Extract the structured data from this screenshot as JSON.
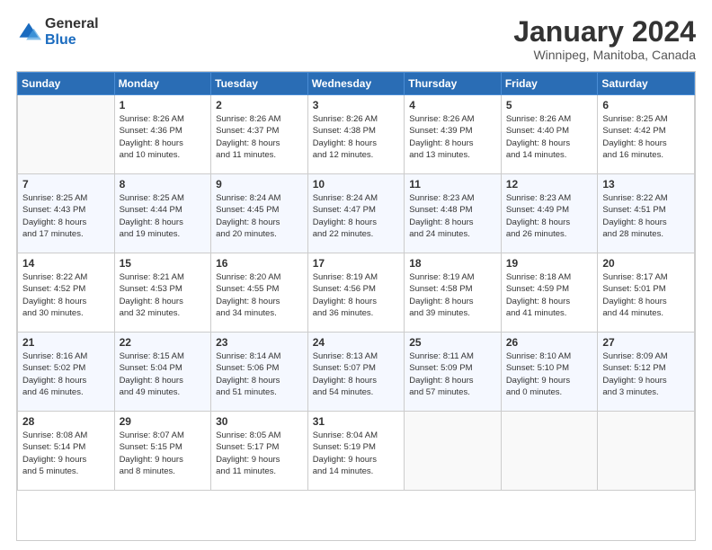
{
  "header": {
    "logo": {
      "general": "General",
      "blue": "Blue"
    },
    "title": "January 2024",
    "subtitle": "Winnipeg, Manitoba, Canada"
  },
  "calendar": {
    "days_of_week": [
      "Sunday",
      "Monday",
      "Tuesday",
      "Wednesday",
      "Thursday",
      "Friday",
      "Saturday"
    ],
    "weeks": [
      [
        {
          "day": "",
          "info": ""
        },
        {
          "day": "1",
          "info": "Sunrise: 8:26 AM\nSunset: 4:36 PM\nDaylight: 8 hours\nand 10 minutes."
        },
        {
          "day": "2",
          "info": "Sunrise: 8:26 AM\nSunset: 4:37 PM\nDaylight: 8 hours\nand 11 minutes."
        },
        {
          "day": "3",
          "info": "Sunrise: 8:26 AM\nSunset: 4:38 PM\nDaylight: 8 hours\nand 12 minutes."
        },
        {
          "day": "4",
          "info": "Sunrise: 8:26 AM\nSunset: 4:39 PM\nDaylight: 8 hours\nand 13 minutes."
        },
        {
          "day": "5",
          "info": "Sunrise: 8:26 AM\nSunset: 4:40 PM\nDaylight: 8 hours\nand 14 minutes."
        },
        {
          "day": "6",
          "info": "Sunrise: 8:25 AM\nSunset: 4:42 PM\nDaylight: 8 hours\nand 16 minutes."
        }
      ],
      [
        {
          "day": "7",
          "info": "Sunrise: 8:25 AM\nSunset: 4:43 PM\nDaylight: 8 hours\nand 17 minutes."
        },
        {
          "day": "8",
          "info": "Sunrise: 8:25 AM\nSunset: 4:44 PM\nDaylight: 8 hours\nand 19 minutes."
        },
        {
          "day": "9",
          "info": "Sunrise: 8:24 AM\nSunset: 4:45 PM\nDaylight: 8 hours\nand 20 minutes."
        },
        {
          "day": "10",
          "info": "Sunrise: 8:24 AM\nSunset: 4:47 PM\nDaylight: 8 hours\nand 22 minutes."
        },
        {
          "day": "11",
          "info": "Sunrise: 8:23 AM\nSunset: 4:48 PM\nDaylight: 8 hours\nand 24 minutes."
        },
        {
          "day": "12",
          "info": "Sunrise: 8:23 AM\nSunset: 4:49 PM\nDaylight: 8 hours\nand 26 minutes."
        },
        {
          "day": "13",
          "info": "Sunrise: 8:22 AM\nSunset: 4:51 PM\nDaylight: 8 hours\nand 28 minutes."
        }
      ],
      [
        {
          "day": "14",
          "info": "Sunrise: 8:22 AM\nSunset: 4:52 PM\nDaylight: 8 hours\nand 30 minutes."
        },
        {
          "day": "15",
          "info": "Sunrise: 8:21 AM\nSunset: 4:53 PM\nDaylight: 8 hours\nand 32 minutes."
        },
        {
          "day": "16",
          "info": "Sunrise: 8:20 AM\nSunset: 4:55 PM\nDaylight: 8 hours\nand 34 minutes."
        },
        {
          "day": "17",
          "info": "Sunrise: 8:19 AM\nSunset: 4:56 PM\nDaylight: 8 hours\nand 36 minutes."
        },
        {
          "day": "18",
          "info": "Sunrise: 8:19 AM\nSunset: 4:58 PM\nDaylight: 8 hours\nand 39 minutes."
        },
        {
          "day": "19",
          "info": "Sunrise: 8:18 AM\nSunset: 4:59 PM\nDaylight: 8 hours\nand 41 minutes."
        },
        {
          "day": "20",
          "info": "Sunrise: 8:17 AM\nSunset: 5:01 PM\nDaylight: 8 hours\nand 44 minutes."
        }
      ],
      [
        {
          "day": "21",
          "info": "Sunrise: 8:16 AM\nSunset: 5:02 PM\nDaylight: 8 hours\nand 46 minutes."
        },
        {
          "day": "22",
          "info": "Sunrise: 8:15 AM\nSunset: 5:04 PM\nDaylight: 8 hours\nand 49 minutes."
        },
        {
          "day": "23",
          "info": "Sunrise: 8:14 AM\nSunset: 5:06 PM\nDaylight: 8 hours\nand 51 minutes."
        },
        {
          "day": "24",
          "info": "Sunrise: 8:13 AM\nSunset: 5:07 PM\nDaylight: 8 hours\nand 54 minutes."
        },
        {
          "day": "25",
          "info": "Sunrise: 8:11 AM\nSunset: 5:09 PM\nDaylight: 8 hours\nand 57 minutes."
        },
        {
          "day": "26",
          "info": "Sunrise: 8:10 AM\nSunset: 5:10 PM\nDaylight: 9 hours\nand 0 minutes."
        },
        {
          "day": "27",
          "info": "Sunrise: 8:09 AM\nSunset: 5:12 PM\nDaylight: 9 hours\nand 3 minutes."
        }
      ],
      [
        {
          "day": "28",
          "info": "Sunrise: 8:08 AM\nSunset: 5:14 PM\nDaylight: 9 hours\nand 5 minutes."
        },
        {
          "day": "29",
          "info": "Sunrise: 8:07 AM\nSunset: 5:15 PM\nDaylight: 9 hours\nand 8 minutes."
        },
        {
          "day": "30",
          "info": "Sunrise: 8:05 AM\nSunset: 5:17 PM\nDaylight: 9 hours\nand 11 minutes."
        },
        {
          "day": "31",
          "info": "Sunrise: 8:04 AM\nSunset: 5:19 PM\nDaylight: 9 hours\nand 14 minutes."
        },
        {
          "day": "",
          "info": ""
        },
        {
          "day": "",
          "info": ""
        },
        {
          "day": "",
          "info": ""
        }
      ]
    ]
  }
}
